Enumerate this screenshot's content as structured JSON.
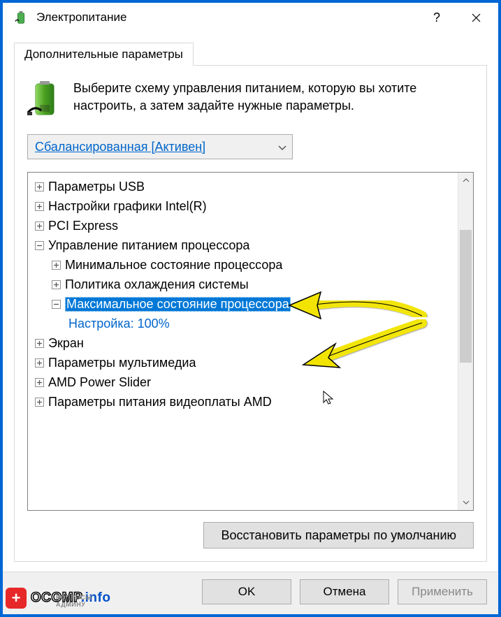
{
  "titlebar": {
    "title": "Электропитание",
    "help": "?",
    "close": "✕"
  },
  "tab": {
    "label": "Дополнительные параметры"
  },
  "instruction": "Выберите схему управления питанием, которую вы хотите настроить, а затем задайте нужные параметры.",
  "plan": {
    "selected": "Сбалансированная [Активен]"
  },
  "tree": {
    "items": [
      {
        "label": "Параметры USB",
        "level": 1,
        "exp": "plus"
      },
      {
        "label": "Настройки графики Intel(R)",
        "level": 1,
        "exp": "plus"
      },
      {
        "label": "PCI Express",
        "level": 1,
        "exp": "plus"
      },
      {
        "label": "Управление питанием процессора",
        "level": 1,
        "exp": "minus"
      },
      {
        "label": "Минимальное состояние процессора",
        "level": 2,
        "exp": "plus"
      },
      {
        "label": "Политика охлаждения системы",
        "level": 2,
        "exp": "plus"
      },
      {
        "label": "Максимальное состояние процессора",
        "level": 2,
        "exp": "minus",
        "selected": true
      },
      {
        "label": "Экран",
        "level": 1,
        "exp": "plus"
      },
      {
        "label": "Параметры мультимедиа",
        "level": 1,
        "exp": "plus"
      },
      {
        "label": "AMD Power Slider",
        "level": 1,
        "exp": "plus"
      },
      {
        "label": "Параметры питания видеоплаты AMD",
        "level": 1,
        "exp": "plus"
      }
    ],
    "setting_label": "Настройка:",
    "setting_value": "100%"
  },
  "restore": {
    "label": "Восстановить параметры по умолчанию"
  },
  "buttons": {
    "ok": "OK",
    "cancel": "Отмена",
    "apply": "Применить"
  },
  "watermark": {
    "brand": "OCOMP",
    "domain": ".info",
    "sub": "ВОПРОСЫ АДМИНУ"
  }
}
